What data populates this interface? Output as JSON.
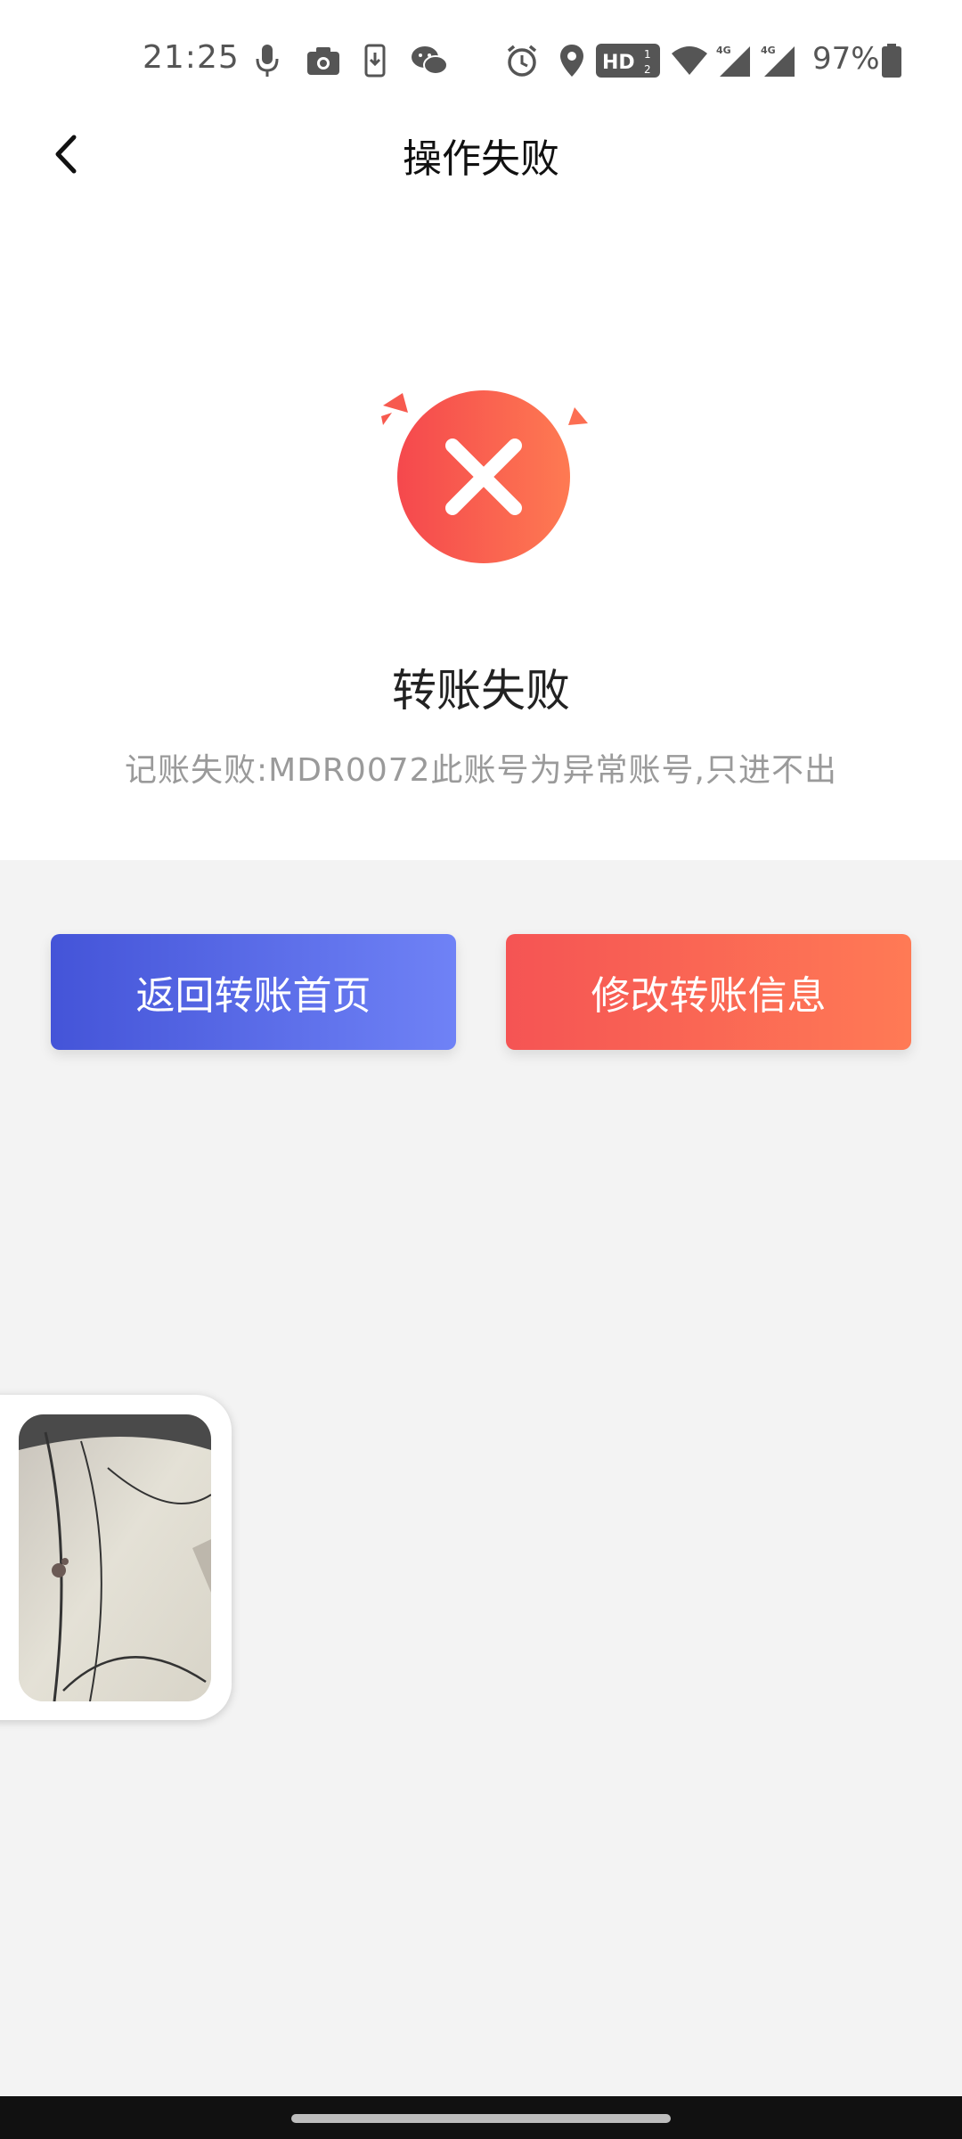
{
  "status_bar": {
    "time": "21:25",
    "battery": "97%",
    "icons": [
      "mic-icon",
      "camera-icon",
      "download-icon",
      "wechat-icon",
      "alarm-icon",
      "location-icon",
      "hd-icon",
      "wifi-icon",
      "signal-4g-icon",
      "signal-4g-icon",
      "battery-icon"
    ]
  },
  "header": {
    "title": "操作失败",
    "back_icon": "chevron-left-icon"
  },
  "result": {
    "icon": "error-x-icon",
    "title": "转账失败",
    "description": "记账失败:MDR0072此账号为异常账号,只进不出"
  },
  "actions": {
    "back_home_label": "返回转账首页",
    "edit_info_label": "修改转账信息"
  },
  "colors": {
    "error": "#f85a4f",
    "primary_blue_start": "#4454d8",
    "primary_blue_end": "#6f82f6",
    "danger_start": "#f55454",
    "danger_end": "#ff7a55",
    "page_bg": "#f3f3f3"
  }
}
